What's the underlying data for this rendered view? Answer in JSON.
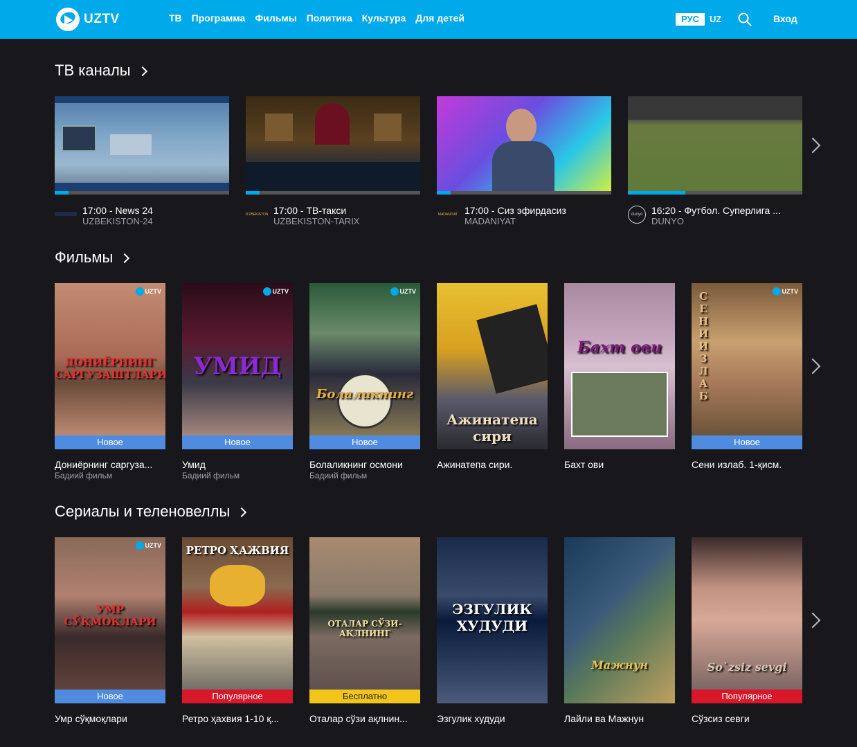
{
  "header": {
    "logo_text": "UZTV",
    "nav": [
      "ТВ",
      "Программа",
      "Фильмы",
      "Политика",
      "Культура",
      "Для детей"
    ],
    "lang_active": "РУС",
    "lang_other": "UZ",
    "login": "Вход"
  },
  "colors": {
    "accent": "#00a9e9",
    "background": "#18171c",
    "badge_new": "#4f8ce0",
    "badge_popular": "#d8172b",
    "badge_free": "#f2c51b"
  },
  "sections": {
    "channels_title": "ТВ каналы",
    "movies_title": "Фильмы",
    "series_title": "Сериалы и теленовеллы"
  },
  "channels": [
    {
      "title": "17:00 - News 24",
      "channel": "UZBEKISTON-24",
      "progress": 0.08
    },
    {
      "title": "17:00 - ТВ-такси",
      "channel": "UZBEKISTON-TARIX",
      "progress": 0.08
    },
    {
      "title": "17:00 - Сиз эфирдасиз",
      "channel": "MADANIYAT",
      "progress": 0.08
    },
    {
      "title": "16:20 - Футбол. Суперлига ...",
      "channel": "DUNYO",
      "progress": 0.33
    }
  ],
  "movies": [
    {
      "title": "Дониёрнинг саргуза...",
      "subtitle": "Бадиий фильм",
      "badge": "Новое",
      "caption": "ДОНИЁРНИНГ САРГУЗАШТЛАРИ"
    },
    {
      "title": "Умид",
      "subtitle": "Бадиий фильм",
      "badge": "Новое",
      "caption": "УМИД"
    },
    {
      "title": "Болаликнинг осмони",
      "subtitle": "Бадиий фильм",
      "badge": "Новое",
      "caption": "Болаликнинг"
    },
    {
      "title": "Ажинатепа сири.",
      "subtitle": "",
      "badge": "",
      "caption": "Ажинатепа сири"
    },
    {
      "title": "Бахт ови",
      "subtitle": "",
      "badge": "",
      "caption": "Бахт ови"
    },
    {
      "title": "Сени излаб. 1-қисм.",
      "subtitle": "",
      "badge": "Новое",
      "caption": "СЕНИ ИЗЛАБ"
    }
  ],
  "series": [
    {
      "title": "Умр сўқмоқлари",
      "badge": "Новое",
      "badge_type": "new",
      "caption": "УМР СЎҚМОҚЛАРИ"
    },
    {
      "title": "Ретро ҳахвия 1-10 қ...",
      "badge": "Популярное",
      "badge_type": "pop",
      "caption": "РЕТРО ҲАЖВИЯ"
    },
    {
      "title": "Оталар сўзи ақлнин...",
      "badge": "Бесплатно",
      "badge_type": "free",
      "caption": "ОТАЛАР СЎЗИ-АҚЛНИНГ"
    },
    {
      "title": "Эзгулик худуди",
      "badge": "",
      "badge_type": "",
      "caption": "ЭЗГУЛИК ХУДУДИ"
    },
    {
      "title": "Лайли ва Мажнун",
      "badge": "",
      "badge_type": "",
      "caption": "Мажнун"
    },
    {
      "title": "Сўзсиз севги",
      "badge": "Популярное",
      "badge_type": "pop",
      "caption": "So`zsiz sevgi"
    }
  ],
  "uztv_mark": "UZTV"
}
